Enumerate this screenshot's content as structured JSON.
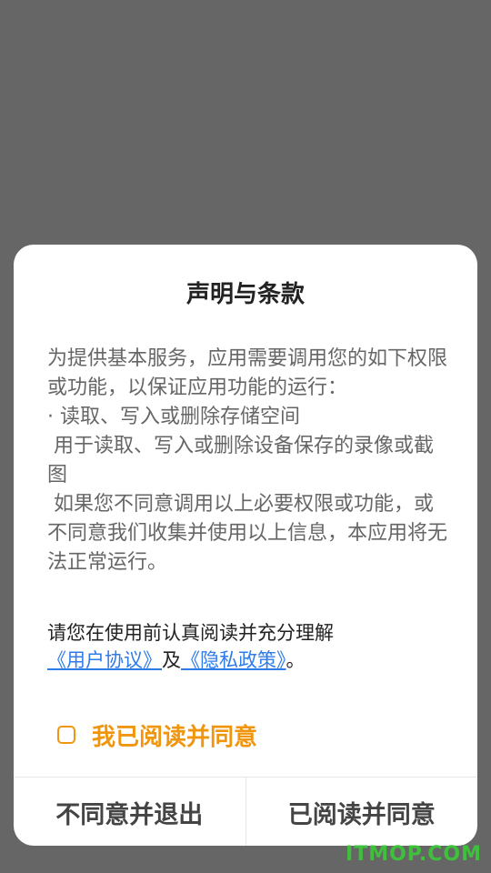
{
  "dialog": {
    "title": "声明与条款",
    "paragraphs": [
      "为提供基本服务，应用需要调用您的如下权限或功能，以保证应用功能的运行：",
      "· 读取、写入或删除存储空间",
      " 用于读取、写入或删除设备保存的录像或截图",
      " 如果您不同意调用以上必要权限或功能，或不同意我们收集并使用以上信息，本应用将无法正常运行。"
    ],
    "consent": {
      "prefix": "请您在使用前认真阅读并充分理解",
      "user_agreement_link": "《用户协议》",
      "and": "及",
      "privacy_policy_link": "《隐私政策》",
      "suffix": "。"
    },
    "agree_checkbox": {
      "label": "我已阅读并同意",
      "checked": false
    },
    "buttons": {
      "disagree_exit": "不同意并退出",
      "read_agree": "已阅读并同意"
    }
  },
  "watermark": "ITMOP.COM",
  "colors": {
    "overlay": "#666666",
    "accent_orange": "#f0960e",
    "link_blue": "#2f7be8",
    "watermark_green": "#3fc03c"
  }
}
